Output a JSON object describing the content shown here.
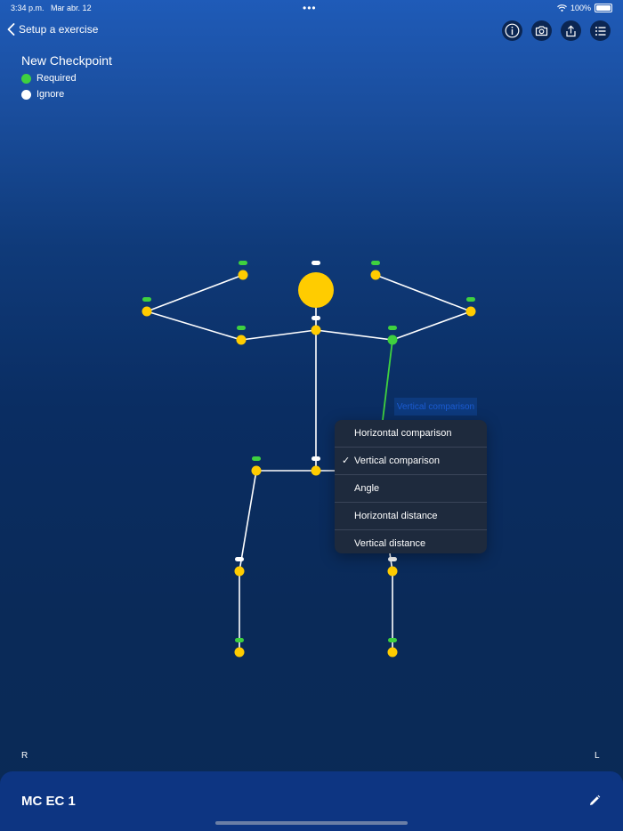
{
  "status": {
    "time": "3:34 p.m.",
    "date": "Mar abr. 12",
    "battery": "100%"
  },
  "nav": {
    "back_label": "Setup a exercise"
  },
  "toolbar": {
    "icons": [
      "info-icon",
      "camera-icon",
      "share-icon",
      "list-icon"
    ]
  },
  "legend": {
    "title": "New Checkpoint",
    "items": [
      {
        "label": "Required",
        "color": "#3fd13f"
      },
      {
        "label": "Ignore",
        "color": "#ffffff"
      }
    ]
  },
  "selected_tag": "Vertical comparison",
  "menu": {
    "items": [
      {
        "label": "Horizontal comparison",
        "checked": false
      },
      {
        "label": "Vertical comparison",
        "checked": true
      },
      {
        "label": "Angle",
        "checked": false
      },
      {
        "label": "Horizontal distance",
        "checked": false
      },
      {
        "label": "Vertical distance",
        "checked": false
      }
    ]
  },
  "sides": {
    "right": "R",
    "left": "L"
  },
  "exercise": {
    "name": "MC EC 1"
  },
  "colors": {
    "joint": "#ffcc00",
    "required": "#3fd13f",
    "ignore": "#ffffff",
    "bone": "#ffffff",
    "selected_bone": "#3fd13f"
  }
}
